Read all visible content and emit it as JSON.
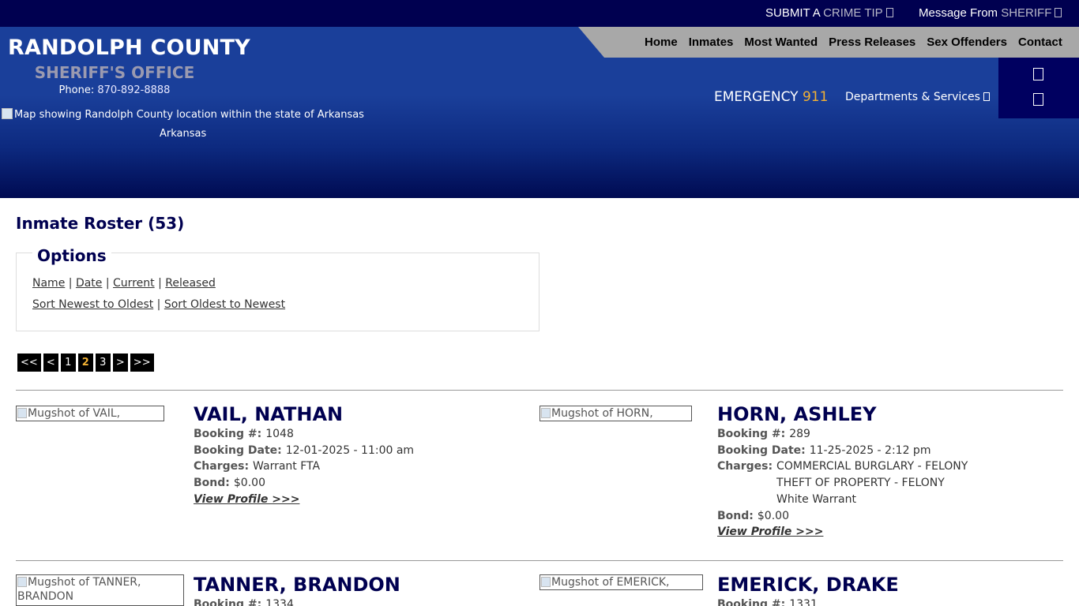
{
  "topbar": {
    "crime_tip_prefix": "SUBMIT A",
    "crime_tip_highlight": "CRIME TIP",
    "message_prefix": "Message From",
    "message_highlight": "SHERIFF"
  },
  "brand": {
    "title": "RANDOLPH COUNTY",
    "subtitle": "SHERIFF'S OFFICE",
    "phone_label": "Phone:",
    "phone_number": "870-892-8888",
    "map_alt": "Map showing Randolph County location within the state of Arkansas",
    "map_state": "Arkansas"
  },
  "nav": [
    "Home",
    "Inmates",
    "Most Wanted",
    "Press Releases",
    "Sex Offenders",
    "Contact"
  ],
  "emergency": {
    "label": "EMERGENCY",
    "number": "911"
  },
  "departments_label": "Departments & Services",
  "roster": {
    "title": "Inmate Roster (53)"
  },
  "options": {
    "legend": "Options",
    "filters": [
      "Name",
      "Date",
      "Current",
      "Released"
    ],
    "sorts": [
      "Sort Newest to Oldest",
      "Sort Oldest to Newest"
    ]
  },
  "pager": {
    "items": [
      "<<",
      "<",
      "1",
      "2",
      "3",
      ">",
      ">>"
    ],
    "current": "2"
  },
  "labels": {
    "booking_no": "Booking #:",
    "booking_date": "Booking Date:",
    "charges": "Charges:",
    "bond": "Bond:",
    "view_profile": "View Profile >>>"
  },
  "inmates": [
    {
      "name": "VAIL, NATHAN",
      "mug_alt": "Mugshot of VAIL, NATHAN",
      "booking_no": "1048",
      "booking_date": "12-01-2025 - 11:00 am",
      "charges": [
        "Warrant FTA"
      ],
      "bond": "$0.00"
    },
    {
      "name": "HORN, ASHLEY",
      "mug_alt": "Mugshot of HORN, ASHLEY",
      "booking_no": "289",
      "booking_date": "11-25-2025 - 2:12 pm",
      "charges": [
        "COMMERCIAL BURGLARY - FELONY",
        "THEFT OF PROPERTY - FELONY",
        "White Warrant"
      ],
      "bond": "$0.00"
    },
    {
      "name": "TANNER, BRANDON",
      "mug_alt": "Mugshot of TANNER, BRANDON",
      "booking_no": "1334"
    },
    {
      "name": "EMERICK, DRAKE",
      "mug_alt": "Mugshot of EMERICK, DRAKE",
      "booking_no": "1331"
    }
  ]
}
